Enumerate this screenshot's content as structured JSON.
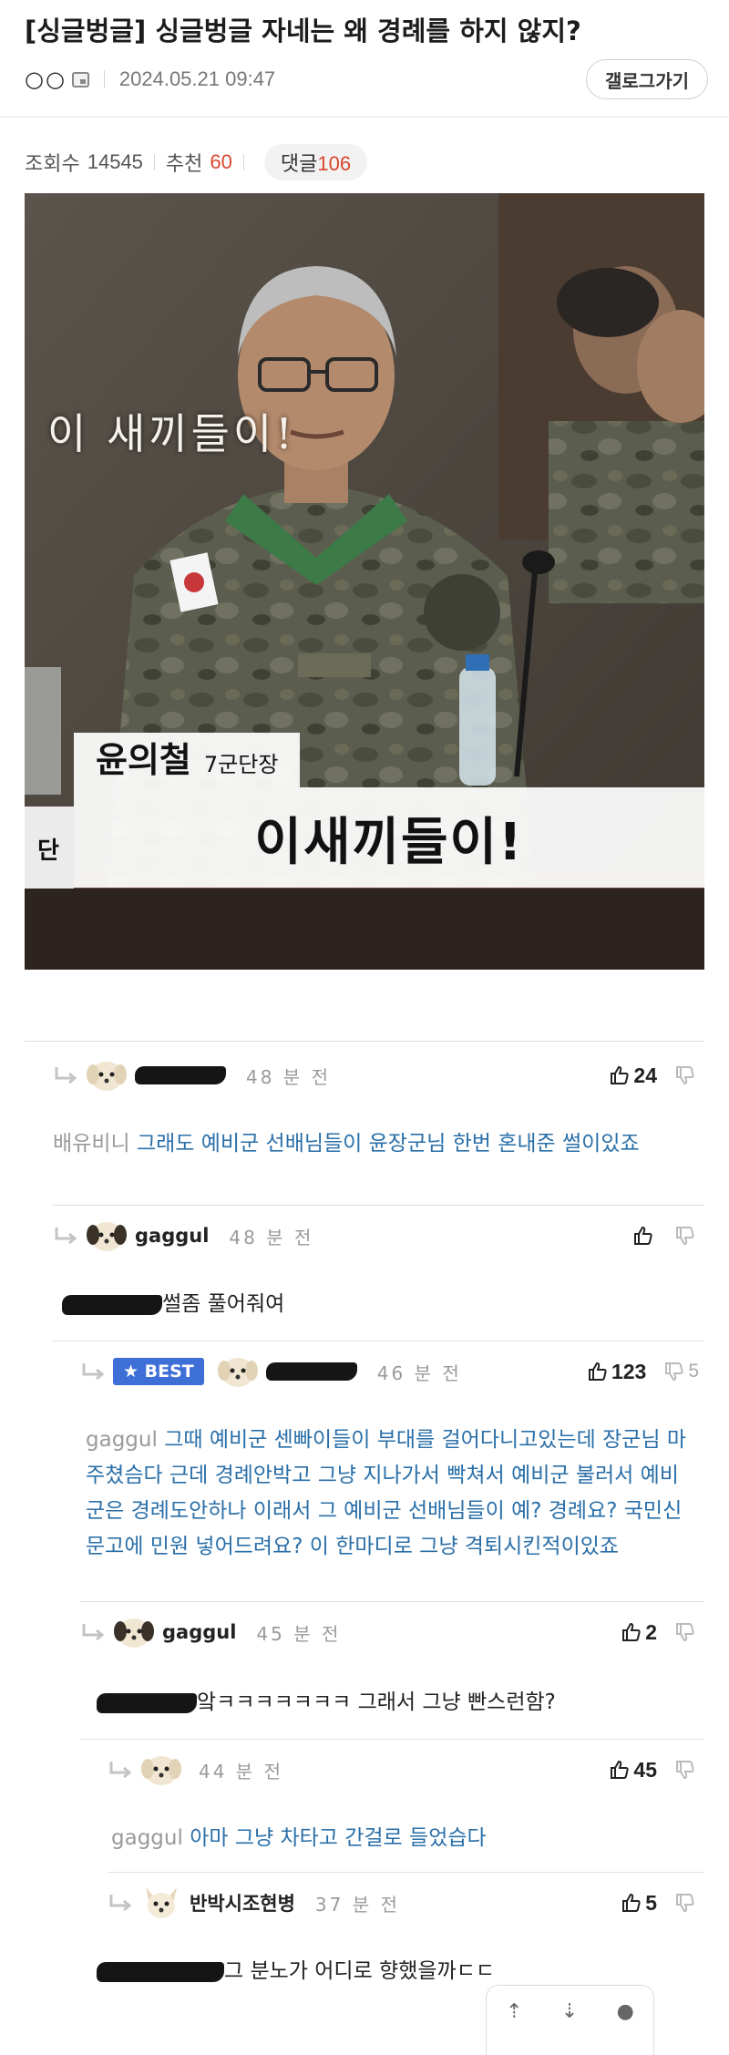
{
  "post": {
    "title": "[싱글벙글] 싱글벙글 자네는 왜 경례를 하지 않지?",
    "author": "○○",
    "date": "2024.05.21 09:47",
    "gallery_button": "갤로그가기",
    "views_label": "조회수",
    "views": "14545",
    "recommend_label": "추천",
    "recommend": "60",
    "comments_label": "댓글",
    "comments_count": "106"
  },
  "image": {
    "overlay_text": "이 새끼들이!",
    "name_caption": "윤의철",
    "role_caption": "7군단장",
    "subtitle": "이새끼들이!",
    "left_card_text": "단"
  },
  "comments": [
    {
      "nick": "",
      "time": "48 분 전",
      "up": "24",
      "down": "",
      "mention": "배유비니",
      "text": "그래도 예비군 선배님들이 윤장군님 한번 혼내준 썰이있죠"
    },
    {
      "nick": "gaggul",
      "time": "48 분 전",
      "up": "",
      "down": "",
      "mention": "",
      "text": "썰좀 풀어줘여"
    },
    {
      "nick": "",
      "best": "BEST",
      "time": "46 분 전",
      "up": "123",
      "down": "5",
      "mention": "gaggul",
      "text": "그때 예비군 센빠이들이 부대를 걸어다니고있는데 장군님 마주쳤슴다 근데 경례안박고 그냥 지나가서 빡쳐서 예비군 불러서 예비군은 경례도안하나 이래서 그 예비군 선배님들이 예? 경례요? 국민신문고에 민원 넣어드려요? 이 한마디로 그냥 격퇴시킨적이있죠"
    },
    {
      "nick": "gaggul",
      "time": "45 분 전",
      "up": "2",
      "down": "",
      "mention": "",
      "text": "앜ㅋㅋㅋㅋㅋㅋㅋ 그래서 그냥 빤스런함?"
    },
    {
      "nick": "",
      "time": "44 분 전",
      "up": "45",
      "down": "",
      "mention": "gaggul",
      "text": "아마 그냥 차타고 간걸로 들었습다"
    },
    {
      "nick": "반박시조현병",
      "time": "37 분 전",
      "up": "5",
      "down": "",
      "mention": "",
      "text": "그 분노가 어디로 향했을까ㄷㄷ"
    }
  ],
  "nav": {
    "up": "⇡",
    "down": "⇣",
    "more": "●"
  }
}
